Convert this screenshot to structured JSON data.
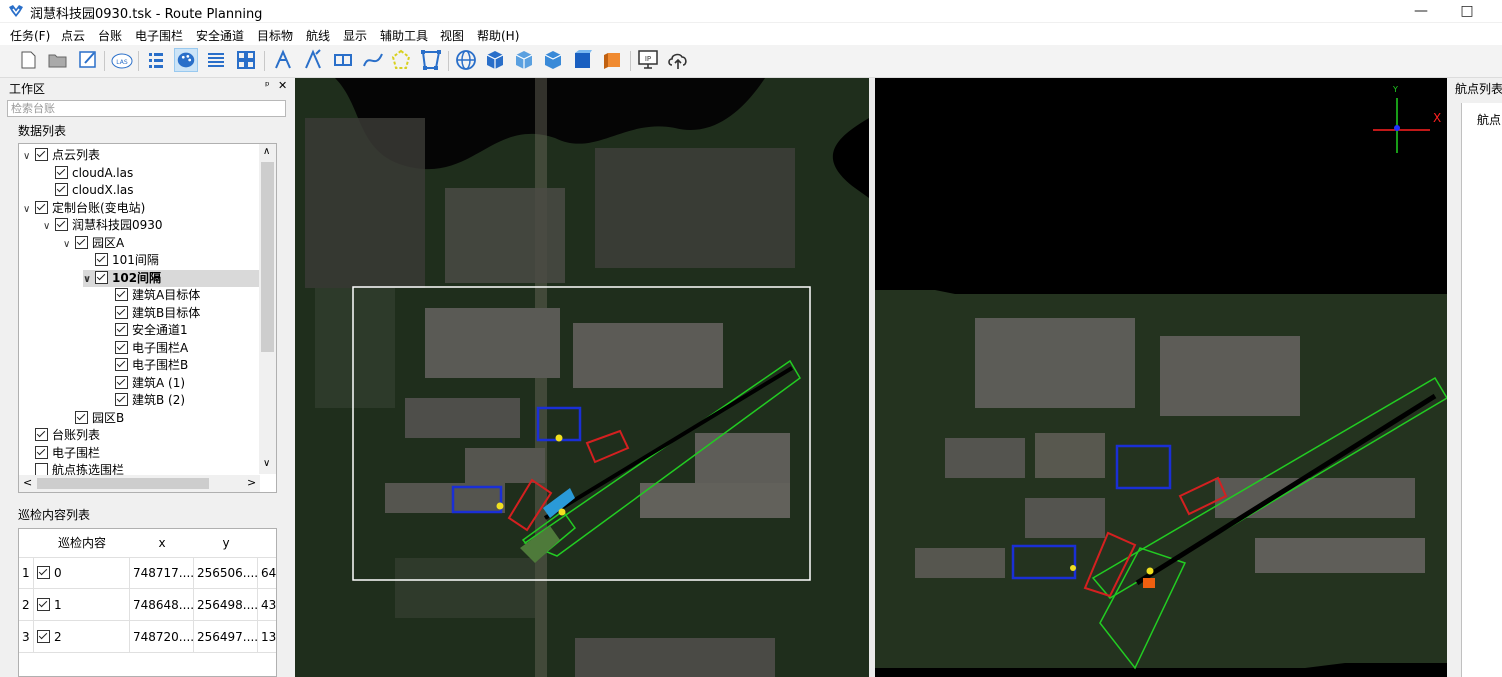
{
  "window": {
    "title": "润慧科技园0930.tsk - Route Planning",
    "minimize_glyph": "—",
    "maximize_glyph": "□"
  },
  "menu": [
    "任务(F)",
    "点云",
    "台账",
    "电子围栏",
    "安全通道",
    "目标物",
    "航线",
    "显示",
    "辅助工具",
    "视图",
    "帮助(H)"
  ],
  "toolbar_icons": [
    "new-file-icon",
    "open-folder-icon",
    "edit-icon",
    "las-icon",
    "list-icon",
    "palette-icon",
    "layers-icon",
    "grid-icon",
    "route-add-icon",
    "route-edit-icon",
    "box-icon",
    "curve-icon",
    "polygon-icon",
    "polygon-select-icon",
    "globe-icon",
    "cube-icon",
    "cube-outline-icon",
    "cube-front-icon",
    "cube-top-icon",
    "cube-side-icon",
    "ip-monitor-icon",
    "upload-icon"
  ],
  "workspace": {
    "title": "工作区",
    "pin_glyph": "ᵖ",
    "close_glyph": "✕",
    "search_placeholder": "检索台账",
    "data_list_label": "数据列表",
    "tree": [
      {
        "label": "点云列表",
        "depth": 0,
        "expander": "∨",
        "checked": true,
        "selected": false
      },
      {
        "label": "cloudA.las",
        "depth": 1,
        "expander": "",
        "checked": true,
        "selected": false
      },
      {
        "label": "cloudX.las",
        "depth": 1,
        "expander": "",
        "checked": true,
        "selected": false
      },
      {
        "label": "定制台账(变电站)",
        "depth": 0,
        "expander": "∨",
        "checked": true,
        "selected": false
      },
      {
        "label": "润慧科技园0930",
        "depth": 1,
        "expander": "∨",
        "checked": true,
        "selected": false
      },
      {
        "label": "园区A",
        "depth": 2,
        "expander": "∨",
        "checked": true,
        "selected": false
      },
      {
        "label": "101间隔",
        "depth": 3,
        "expander": "",
        "checked": true,
        "selected": false
      },
      {
        "label": "102间隔",
        "depth": 3,
        "expander": "∨",
        "checked": true,
        "selected": true
      },
      {
        "label": "建筑A目标体",
        "depth": 4,
        "expander": "",
        "checked": true,
        "selected": false
      },
      {
        "label": "建筑B目标体",
        "depth": 4,
        "expander": "",
        "checked": true,
        "selected": false
      },
      {
        "label": "安全通道1",
        "depth": 4,
        "expander": "",
        "checked": true,
        "selected": false
      },
      {
        "label": "电子围栏A",
        "depth": 4,
        "expander": "",
        "checked": true,
        "selected": false
      },
      {
        "label": "电子围栏B",
        "depth": 4,
        "expander": "",
        "checked": true,
        "selected": false
      },
      {
        "label": "建筑A (1)",
        "depth": 4,
        "expander": "",
        "checked": true,
        "selected": false
      },
      {
        "label": "建筑B (2)",
        "depth": 4,
        "expander": "",
        "checked": true,
        "selected": false
      },
      {
        "label": "园区B",
        "depth": 2,
        "expander": "",
        "checked": true,
        "selected": false
      },
      {
        "label": "台账列表",
        "depth": 0,
        "expander": "",
        "checked": true,
        "selected": false
      },
      {
        "label": "电子围栏",
        "depth": 0,
        "expander": "",
        "checked": true,
        "selected": false
      },
      {
        "label": "航点拣选围栏",
        "depth": 0,
        "expander": "",
        "checked": false,
        "selected": false
      }
    ],
    "scroll_up": "∧",
    "scroll_down": "∨",
    "scroll_left": "<",
    "scroll_right": ">"
  },
  "inspection": {
    "title": "巡检内容列表",
    "columns": [
      "巡检内容",
      "x",
      "y"
    ],
    "rows": [
      {
        "index": "1",
        "content": "0",
        "x": "748717....",
        "y": "256506....",
        "z": "64"
      },
      {
        "index": "2",
        "content": "1",
        "x": "748648....",
        "y": "256498....",
        "z": "43"
      },
      {
        "index": "3",
        "content": "2",
        "x": "748720....",
        "y": "256497....",
        "z": "13"
      }
    ]
  },
  "axis": {
    "x_label": "X",
    "y_label": "Y"
  },
  "waypoint_panel": {
    "title": "航点列表",
    "tab": "航点"
  },
  "colors": {
    "fence_red": "#d42020",
    "target_blue": "#1a2fd6",
    "channel_green": "#22cc22",
    "waypoint_yellow": "#f0e020",
    "select_white": "#ffffff",
    "axis_red": "#ff2020",
    "axis_green": "#20d020"
  }
}
